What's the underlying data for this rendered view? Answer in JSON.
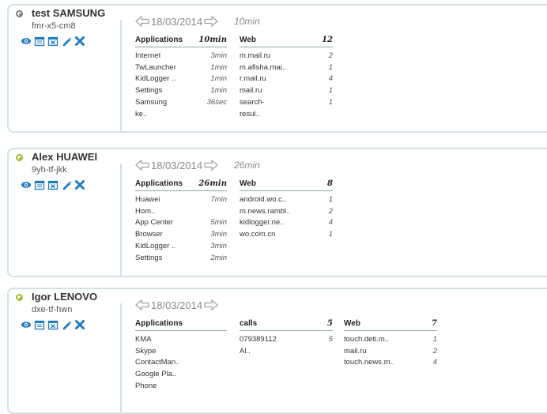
{
  "devices": [
    {
      "name": "test SAMSUNG",
      "id": "fmr-x5-cm8",
      "status_color": "#7d7d7d",
      "date": "18/03/2014",
      "total": "10min",
      "columns": [
        {
          "title": "Applications",
          "count": "10min",
          "items": [
            [
              "Internet",
              "3min"
            ],
            [
              "TwLauncher",
              "1min"
            ],
            [
              "KidLogger ..",
              "1min"
            ],
            [
              "Settings",
              "1min"
            ],
            [
              "Samsung",
              "36sec"
            ],
            [
              "ke..",
              ""
            ]
          ]
        },
        {
          "title": "Web",
          "count": "12",
          "items": [
            [
              "m.mail.ru",
              "2"
            ],
            [
              "m.afisha.mai..",
              "1"
            ],
            [
              "r.mail.ru",
              "4"
            ],
            [
              "mail.ru",
              "1"
            ],
            [
              "search-",
              "1"
            ],
            [
              "resul..",
              ""
            ]
          ]
        }
      ]
    },
    {
      "name": "Alex HUAWEI",
      "id": "9yh-tf-jkk",
      "status_color": "#a8b72b",
      "date": "18/03/2014",
      "total": "26min",
      "columns": [
        {
          "title": "Applications",
          "count": "26min",
          "items": [
            [
              "Huawei",
              "7min"
            ],
            [
              "Hom..",
              ""
            ],
            [
              "App Center",
              "5min"
            ],
            [
              "Browser",
              "3min"
            ],
            [
              "KidLogger ..",
              "3min"
            ],
            [
              "Settings",
              "2min"
            ]
          ]
        },
        {
          "title": "Web",
          "count": "8",
          "items": [
            [
              "android.wo.c..",
              "1"
            ],
            [
              "m.news.rambl..",
              "2"
            ],
            [
              "kidlogger.ne..",
              "4"
            ],
            [
              "wo.com.cn",
              "1"
            ]
          ]
        }
      ]
    },
    {
      "name": "Igor LENOVO",
      "id": "dxe-tf-hwn",
      "status_color": "#a8b72b",
      "date": "18/03/2014",
      "total": "",
      "columns": [
        {
          "title": "Applications",
          "count": "",
          "items": [
            [
              "KMA",
              ""
            ],
            [
              "Skype",
              ""
            ],
            [
              "ContactMan..",
              ""
            ],
            [
              "Google Pla..",
              ""
            ],
            [
              "Phone",
              ""
            ]
          ]
        },
        {
          "title": "calls",
          "count": "5",
          "items": [
            [
              "079389112",
              "5"
            ],
            [
              "Al..",
              ""
            ]
          ]
        },
        {
          "title": "Web",
          "count": "7",
          "items": [
            [
              "touch.deti.m..",
              "1"
            ],
            [
              "mail.ru",
              "2"
            ],
            [
              "touch.news.m..",
              "4"
            ]
          ]
        }
      ]
    }
  ],
  "actions": [
    {
      "name": "view-icon",
      "color": "#1f7bc0"
    },
    {
      "name": "calendar-icon",
      "color": "#1f7bc0"
    },
    {
      "name": "delete-calendar-icon",
      "color": "#1f7bc0"
    },
    {
      "name": "edit-icon",
      "color": "#1f7bc0"
    },
    {
      "name": "remove-icon",
      "color": "#1f7bc0"
    }
  ]
}
